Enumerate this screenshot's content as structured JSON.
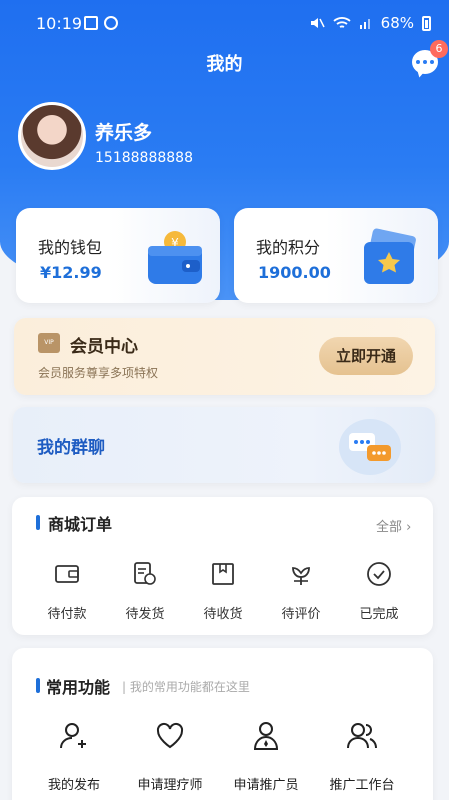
{
  "status": {
    "time": "10:19",
    "battery": "68%"
  },
  "header": {
    "title": "我的",
    "message_count": "6"
  },
  "user": {
    "name": "养乐多",
    "phone": "15188888888"
  },
  "wallet": {
    "title": "我的钱包",
    "value": "¥12.99"
  },
  "points": {
    "title": "我的积分",
    "value": "1900.00"
  },
  "vip": {
    "badge": "VIP",
    "title": "会员中心",
    "subtitle": "会员服务尊享多项特权",
    "button": "立即开通"
  },
  "group": {
    "title": "我的群聊"
  },
  "orders": {
    "title": "商城订单",
    "all_label": "全部",
    "items": [
      {
        "label": "待付款",
        "icon": "wallet-icon"
      },
      {
        "label": "待发货",
        "icon": "receipt-clock-icon"
      },
      {
        "label": "待收货",
        "icon": "box-icon"
      },
      {
        "label": "待评价",
        "icon": "flower-icon"
      },
      {
        "label": "已完成",
        "icon": "check-circle-icon"
      }
    ]
  },
  "functions": {
    "title": "常用功能",
    "subtitle": "我的常用功能都在这里",
    "items": [
      {
        "label": "我的发布",
        "icon": "user-plus-icon"
      },
      {
        "label": "申请理疗师",
        "icon": "heart-icon"
      },
      {
        "label": "申请推广员",
        "icon": "user-badge-icon"
      },
      {
        "label": "推广工作台",
        "icon": "users-icon"
      }
    ]
  },
  "colors": {
    "primary": "#1f6ff0",
    "accent": "#1e6fd9",
    "vip_bg": "#fbeedb",
    "badge": "#ff6b5d"
  }
}
